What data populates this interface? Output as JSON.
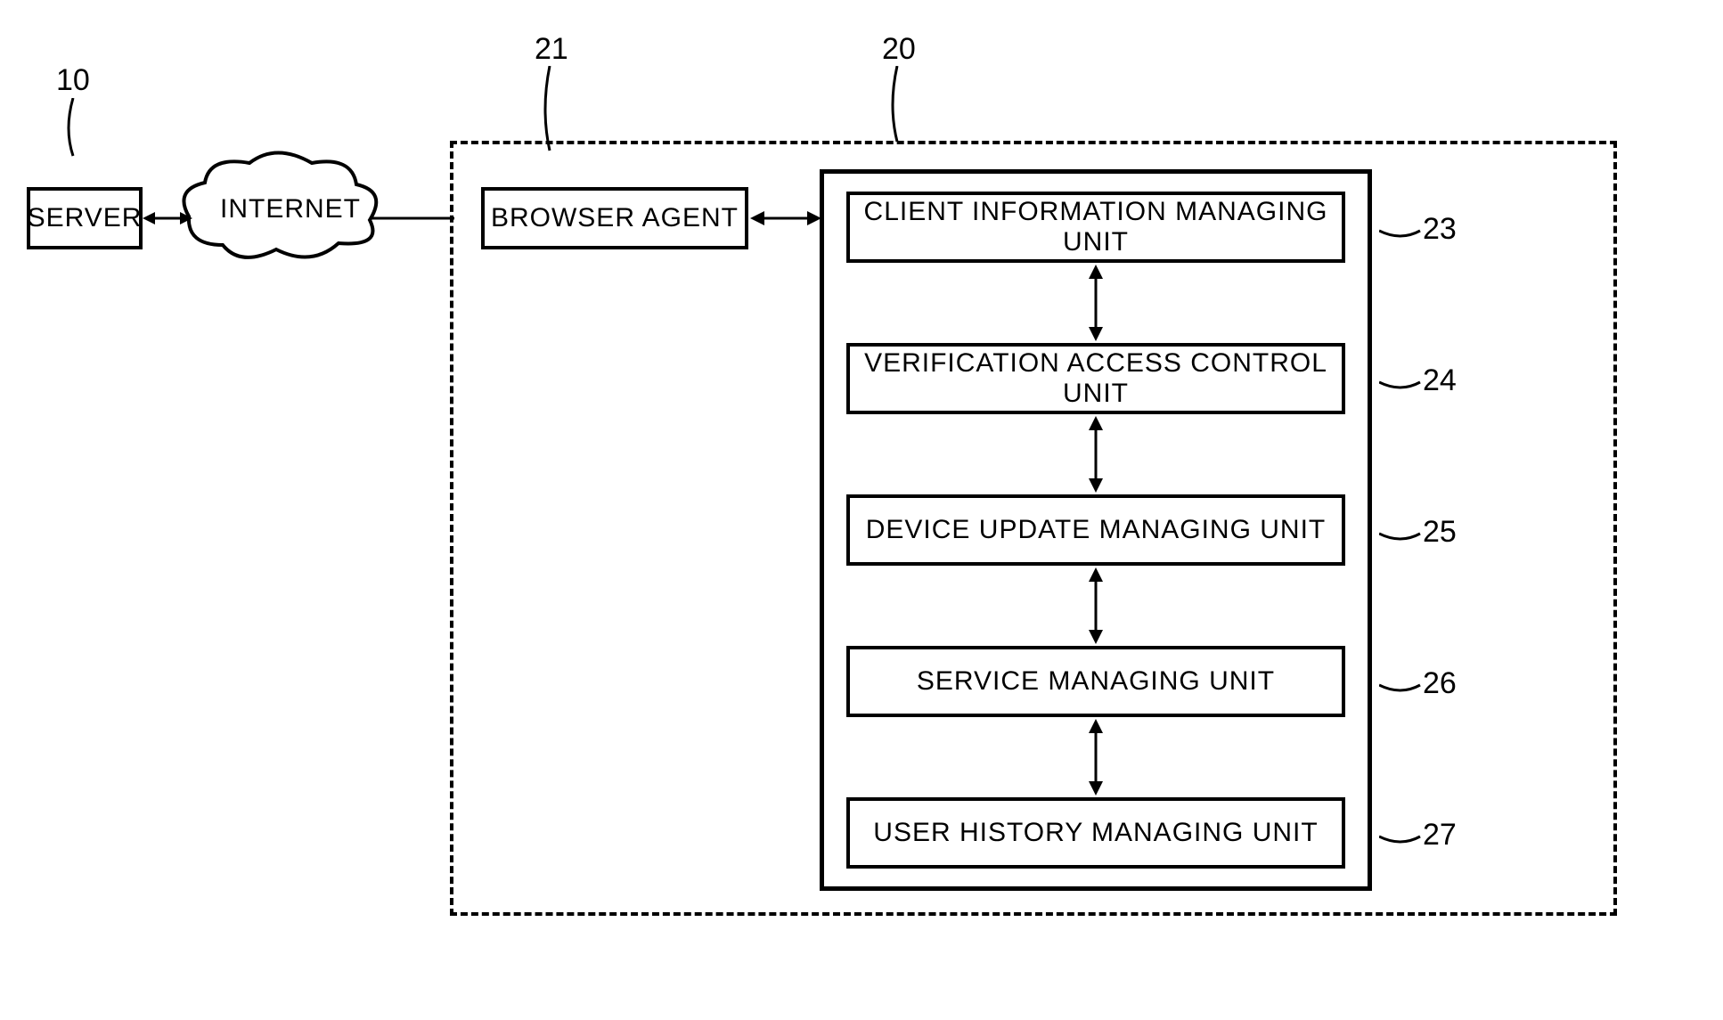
{
  "labels": {
    "server_ref": "10",
    "browser_ref": "21",
    "outer_ref": "20",
    "u23_ref": "23",
    "u24_ref": "24",
    "u25_ref": "25",
    "u26_ref": "26",
    "u27_ref": "27"
  },
  "boxes": {
    "server": "SERVER",
    "internet": "INTERNET",
    "browser": "BROWSER AGENT",
    "u23": "CLIENT INFORMATION MANAGING UNIT",
    "u24": "VERIFICATION ACCESS CONTROL UNIT",
    "u25": "DEVICE UPDATE MANAGING UNIT",
    "u26": "SERVICE MANAGING UNIT",
    "u27": "USER HISTORY MANAGING UNIT"
  }
}
